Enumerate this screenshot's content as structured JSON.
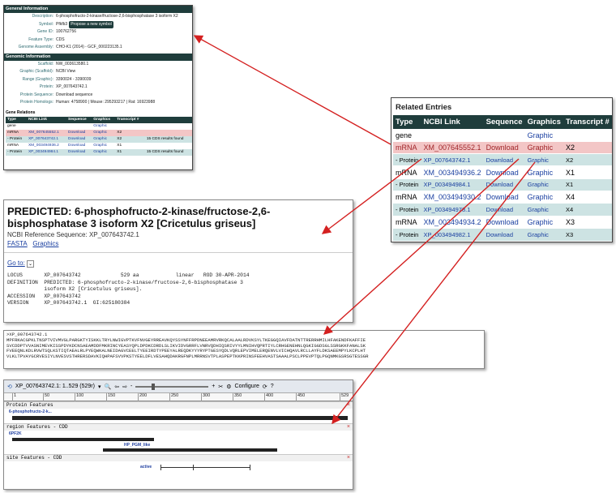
{
  "general": {
    "section_general": "General Information",
    "rows": [
      {
        "k": "Description:",
        "v": "6-phosphofructo-2-kinase/fructose-2,6-bisphosphatase 3 isoform X2"
      },
      {
        "k": "Symbol:",
        "v": "Pfkfb3",
        "btn": "Propose a new symbol"
      },
      {
        "k": "Gene ID:",
        "v": "100762756"
      },
      {
        "k": "Feature Type:",
        "v": "CDS"
      },
      {
        "k": "Genome Assembly:",
        "v": "CHO-K1 (2014) - GCF_000223135.1"
      }
    ],
    "section_genomic": "Genomic Information",
    "rows2": [
      {
        "k": "Scaffold:",
        "v": "NW_003613580.1"
      },
      {
        "k": "Graphic (Scaffold):",
        "v": "NCBI View"
      },
      {
        "k": "Range (Graphic):",
        "v": "3390024 - 3390039"
      },
      {
        "k": "Protein:",
        "v": "XP_007643742.1"
      },
      {
        "k": "Protein Sequence:",
        "v": "Download sequence"
      },
      {
        "k": "Protein Homologs:",
        "v": "Human: 4758900 | Mouse: 295293217 | Rat: 16923988"
      }
    ],
    "gene_relations": "Gene Relations",
    "table_headers": [
      "Type",
      "NCBI Link",
      "Sequence",
      "Graphics",
      "Transcript #",
      ""
    ],
    "table_rows": [
      [
        "gene",
        "",
        "",
        "Graphic",
        "",
        ""
      ],
      [
        "mRNA",
        "XM_007645552.1",
        "Download",
        "Graphic",
        "X2",
        ""
      ],
      [
        "- Protein",
        "XP_007643742.1",
        "Download",
        "Graphic",
        "X2",
        "15 CDS results found"
      ],
      [
        "mRNA",
        "XM_003494936.2",
        "Download",
        "Graphic",
        "X1",
        ""
      ],
      [
        "- Protein",
        "XP_003494984.1",
        "Download",
        "Graphic",
        "X1",
        "15 CDS results found"
      ]
    ]
  },
  "related": {
    "title": "Related Entries",
    "headers": [
      "Type",
      "NCBI Link",
      "Sequence",
      "Graphics",
      "Transcript #"
    ],
    "rows": [
      {
        "type": "gene",
        "link": "",
        "seq": "",
        "gfx": "Graphic",
        "tr": "",
        "style": "white"
      },
      {
        "type": "mRNA",
        "link": "XM_007645552.1",
        "seq": "Download",
        "gfx": "Graphic",
        "tr": "X2",
        "style": "pink"
      },
      {
        "type": "- Protein",
        "link": "XP_007643742.1",
        "seq": "Download",
        "gfx": "Graphic",
        "tr": "X2",
        "style": "teal"
      },
      {
        "type": "mRNA",
        "link": "XM_003494936.2",
        "seq": "Download",
        "gfx": "Graphic",
        "tr": "X1",
        "style": "white"
      },
      {
        "type": "- Protein",
        "link": "XP_003494984.1",
        "seq": "Download",
        "gfx": "Graphic",
        "tr": "X1",
        "style": "teal"
      },
      {
        "type": "mRNA",
        "link": "XM_003494930.2",
        "seq": "Download",
        "gfx": "Graphic",
        "tr": "X4",
        "style": "white"
      },
      {
        "type": "- Protein",
        "link": "XP_003494978.1",
        "seq": "Download",
        "gfx": "Graphic",
        "tr": "X4",
        "style": "teal"
      },
      {
        "type": "mRNA",
        "link": "XM_003494934.2",
        "seq": "Download",
        "gfx": "Graphic",
        "tr": "X3",
        "style": "white"
      },
      {
        "type": "- Protein",
        "link": "XP_003494982.1",
        "seq": "Download",
        "gfx": "Graphic",
        "tr": "X3",
        "style": "teal"
      }
    ]
  },
  "predicted": {
    "title": "PREDICTED: 6-phosphofructo-2-kinase/fructose-2,6-bisphosphatase 3 isoform X2 [Cricetulus griseus]",
    "ref": "NCBI Reference Sequence: XP_007643742.1",
    "link_fasta": "FASTA",
    "link_graphics": "Graphics",
    "goto": "Go to:",
    "record": "LOCUS       XP_007643742             529 aa            linear   ROD 30-APR-2014\nDEFINITION  PREDICTED: 6-phosphofructo-2-kinase/fructose-2,6-bisphosphatase 3\n            isoform X2 [Cricetulus griseus].\nACCESSION   XP_007643742\nVERSION     XP_007643742.1  GI:625180384"
  },
  "fasta": {
    "header": ">XP_007643742.1",
    "lines": [
      "MPFRKACGPKLTNSPTVIVMVGLPARGKTYISKKLTRYLNWIGVPTKVFNVGEYRREAVKQYSSYNFFRPDNEEAMRVRKQCALAALRDVKSYLTKEGGQIAVFDATNTTRERRHMILHFAKENDFKAFFIE",
      "SVCDDPTVVASNIMEVKISSPDYKDCNSAEAMDDFMKRINCYEASYQPLDPDKCDRDLSLIKVIDVGRRFLVNRVQDHIQSRIVYYLMNIHVQPRTIYLCRHGENEHNLQGKIGGDSGLSSRGKKFANALSK",
      "FVEEQNLKDLRVWTSQLKSTIQTAEALRLPYEQWKALNEIDAGVCEELTYEEIRDTYPEEYALREQDKYYYRYPTGESYQDLVQRLEPVIMELERQENVLVICHQAVLRCLLAYFLDKSAEEMPYLKCPLHT",
      "VLKLTPVAYGCRVESIYLNVESVSTHRERSDAVKIQHPAFSVVPKSTYEELDFLVESAHQDAKRGFNPLMRRNSVTPLASPEPTKKPRINSFEEHVASTSAAALPSCLPPEVPTQLPGQNMKGSRSGTESSGR"
    ]
  },
  "viewer": {
    "tab": "XP_007643742.1: 1..529 (529r)",
    "configure": "Configure",
    "ruler": [
      "1",
      "50",
      "100",
      "150",
      "200",
      "250",
      "300",
      "350",
      "400",
      "450",
      "529"
    ],
    "tracks": [
      {
        "name": "Protein Features",
        "label": "6-phosphofructo-2-k..."
      },
      {
        "name": "region Features - CDD",
        "label": "6PF2K",
        "label2": "HP_PGM_like"
      },
      {
        "name": "site Features - CDD",
        "label": "active"
      }
    ]
  }
}
